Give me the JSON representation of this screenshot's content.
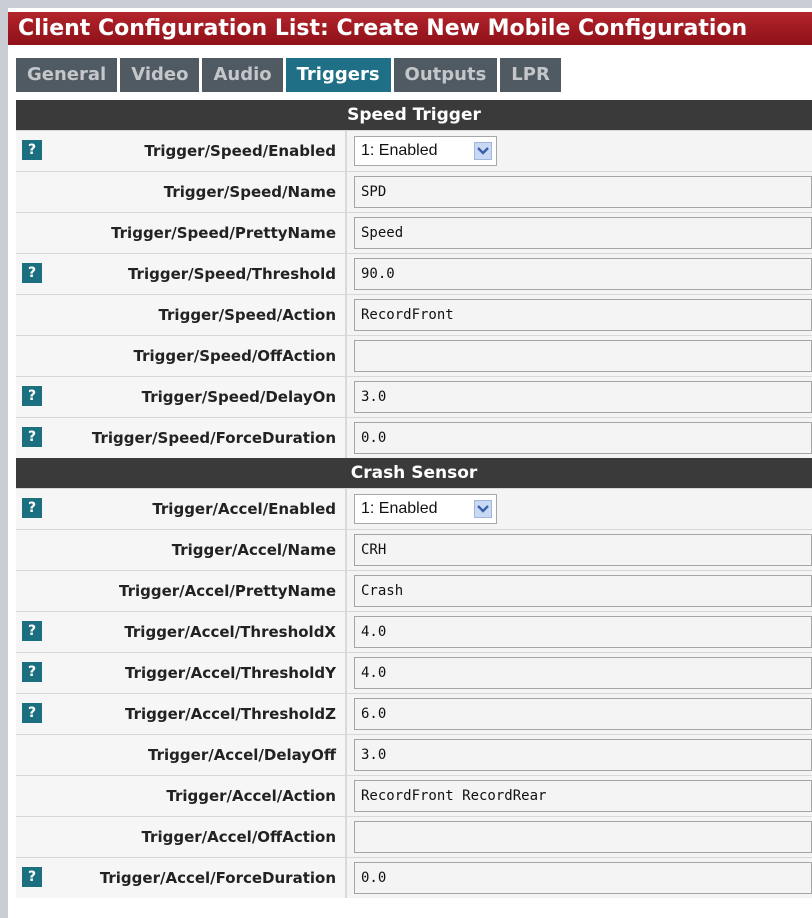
{
  "title": "Client Configuration List: Create New Mobile Configuration",
  "tabs": [
    "General",
    "Video",
    "Audio",
    "Triggers",
    "Outputs",
    "LPR"
  ],
  "active_tab": "Triggers",
  "help_glyph": "?",
  "sections": [
    {
      "heading": "Speed Trigger",
      "rows": [
        {
          "label": "Trigger/Speed/Enabled",
          "help": true,
          "type": "select",
          "value": "1: Enabled"
        },
        {
          "label": "Trigger/Speed/Name",
          "help": false,
          "type": "text",
          "value": "SPD"
        },
        {
          "label": "Trigger/Speed/PrettyName",
          "help": false,
          "type": "text",
          "value": "Speed"
        },
        {
          "label": "Trigger/Speed/Threshold",
          "help": true,
          "type": "text",
          "value": "90.0"
        },
        {
          "label": "Trigger/Speed/Action",
          "help": false,
          "type": "text",
          "value": "RecordFront"
        },
        {
          "label": "Trigger/Speed/OffAction",
          "help": false,
          "type": "text",
          "value": ""
        },
        {
          "label": "Trigger/Speed/DelayOn",
          "help": true,
          "type": "text",
          "value": "3.0"
        },
        {
          "label": "Trigger/Speed/ForceDuration",
          "help": true,
          "type": "text",
          "value": "0.0"
        }
      ]
    },
    {
      "heading": "Crash Sensor",
      "rows": [
        {
          "label": "Trigger/Accel/Enabled",
          "help": true,
          "type": "select",
          "value": "1: Enabled"
        },
        {
          "label": "Trigger/Accel/Name",
          "help": false,
          "type": "text",
          "value": "CRH"
        },
        {
          "label": "Trigger/Accel/PrettyName",
          "help": false,
          "type": "text",
          "value": "Crash"
        },
        {
          "label": "Trigger/Accel/ThresholdX",
          "help": true,
          "type": "text",
          "value": "4.0"
        },
        {
          "label": "Trigger/Accel/ThresholdY",
          "help": true,
          "type": "text",
          "value": "4.0"
        },
        {
          "label": "Trigger/Accel/ThresholdZ",
          "help": true,
          "type": "text",
          "value": "6.0"
        },
        {
          "label": "Trigger/Accel/DelayOff",
          "help": false,
          "type": "text",
          "value": "3.0"
        },
        {
          "label": "Trigger/Accel/Action",
          "help": false,
          "type": "text",
          "value": "RecordFront RecordRear"
        },
        {
          "label": "Trigger/Accel/OffAction",
          "help": false,
          "type": "text",
          "value": ""
        },
        {
          "label": "Trigger/Accel/ForceDuration",
          "help": true,
          "type": "text",
          "value": "0.0"
        }
      ]
    }
  ]
}
